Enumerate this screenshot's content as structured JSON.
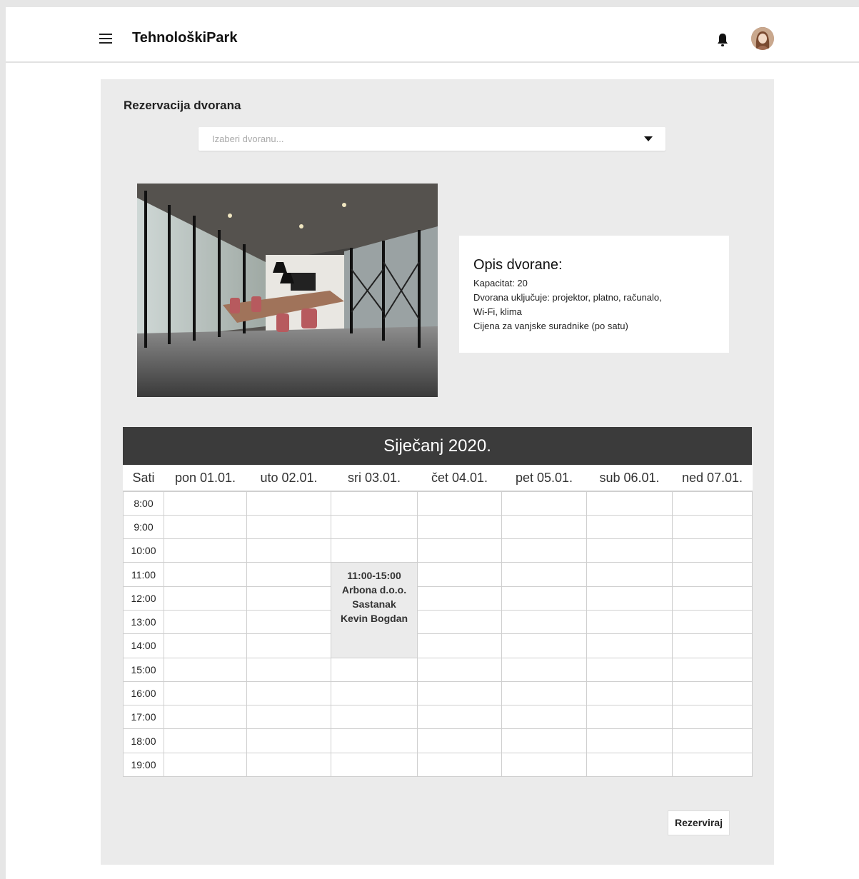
{
  "app": {
    "title": "TehnološkiPark"
  },
  "page": {
    "section_title": "Rezervacija dvorana",
    "select_placeholder": "Izaberi dvoranu..."
  },
  "hall": {
    "info_title": "Opis dvorane:",
    "capacity": "Kapacitat: 20",
    "includes": "Dvorana uključuje: projektor, platno, računalo,",
    "includes_cont": "Wi-Fi, klima",
    "price": "Cijena za vanjske suradnike (po satu)"
  },
  "calendar": {
    "month": "Siječanj 2020.",
    "hour_header": "Sati",
    "days": [
      "pon 01.01.",
      "uto 02.01.",
      "sri 03.01.",
      "čet 04.01.",
      "pet 05.01.",
      "sub 06.01.",
      "ned 07.01."
    ],
    "hours": [
      "8:00",
      "9:00",
      "10:00",
      "11:00",
      "12:00",
      "13:00",
      "14:00",
      "15:00",
      "16:00",
      "17:00",
      "18:00",
      "19:00"
    ],
    "booking": {
      "time": "11:00-15:00",
      "company": "Arbona d.o.o.",
      "type": "Sastanak",
      "person": "Kevin Bogdan"
    }
  },
  "actions": {
    "reserve_label": "Rezerviraj"
  },
  "colors": {
    "card_bg": "#ebebeb",
    "calendar_header_bg": "#3b3b3b"
  }
}
